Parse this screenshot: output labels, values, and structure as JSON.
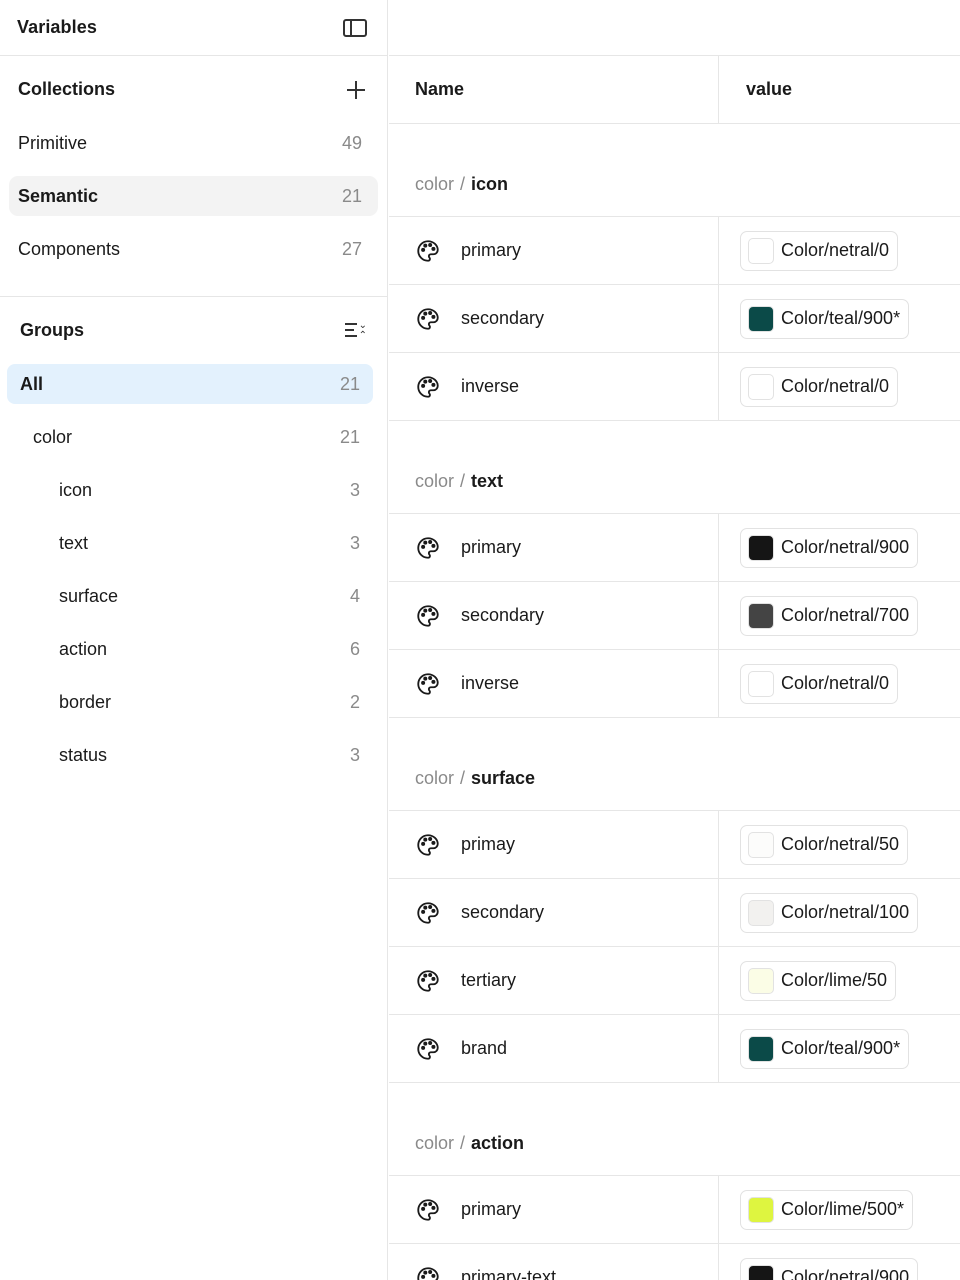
{
  "sidebar": {
    "title": "Variables",
    "collections": {
      "label": "Collections",
      "items": [
        {
          "label": "Primitive",
          "count": "49",
          "selected": false
        },
        {
          "label": "Semantic",
          "count": "21",
          "selected": true
        },
        {
          "label": "Components",
          "count": "27",
          "selected": false
        }
      ]
    },
    "groups": {
      "label": "Groups",
      "items": [
        {
          "label": "All",
          "count": "21",
          "level": 0,
          "selected": true
        },
        {
          "label": "color",
          "count": "21",
          "level": 1,
          "selected": false
        },
        {
          "label": "icon",
          "count": "3",
          "level": 2,
          "selected": false
        },
        {
          "label": "text",
          "count": "3",
          "level": 2,
          "selected": false
        },
        {
          "label": "surface",
          "count": "4",
          "level": 2,
          "selected": false
        },
        {
          "label": "action",
          "count": "6",
          "level": 2,
          "selected": false
        },
        {
          "label": "border",
          "count": "2",
          "level": 2,
          "selected": false
        },
        {
          "label": "status",
          "count": "3",
          "level": 2,
          "selected": false
        }
      ]
    }
  },
  "table": {
    "headers": {
      "name": "Name",
      "value": "value"
    },
    "groups": [
      {
        "prefix": "color",
        "separator": "/",
        "name": "icon",
        "rows": [
          {
            "name": "primary",
            "value": "Color/netral/0",
            "swatch": "#ffffff"
          },
          {
            "name": "secondary",
            "value": "Color/teal/900*",
            "swatch": "#0b4a48"
          },
          {
            "name": "inverse",
            "value": "Color/netral/0",
            "swatch": "#ffffff"
          }
        ]
      },
      {
        "prefix": "color",
        "separator": "/",
        "name": "text",
        "rows": [
          {
            "name": "primary",
            "value": "Color/netral/900",
            "swatch": "#151515"
          },
          {
            "name": "secondary",
            "value": "Color/netral/700",
            "swatch": "#444444"
          },
          {
            "name": "inverse",
            "value": "Color/netral/0",
            "swatch": "#ffffff"
          }
        ]
      },
      {
        "prefix": "color",
        "separator": "/",
        "name": "surface",
        "rows": [
          {
            "name": "primay",
            "value": "Color/netral/50",
            "swatch": "#fcfcfb"
          },
          {
            "name": "secondary",
            "value": "Color/netral/100",
            "swatch": "#f2f1ef"
          },
          {
            "name": "tertiary",
            "value": "Color/lime/50",
            "swatch": "#fbfde6"
          },
          {
            "name": "brand",
            "value": "Color/teal/900*",
            "swatch": "#0b4a48"
          }
        ]
      },
      {
        "prefix": "color",
        "separator": "/",
        "name": "action",
        "rows": [
          {
            "name": "primary",
            "value": "Color/lime/500*",
            "swatch": "#def540"
          },
          {
            "name": "primary-text",
            "value": "Color/netral/900",
            "swatch": "#151515"
          }
        ]
      }
    ]
  }
}
